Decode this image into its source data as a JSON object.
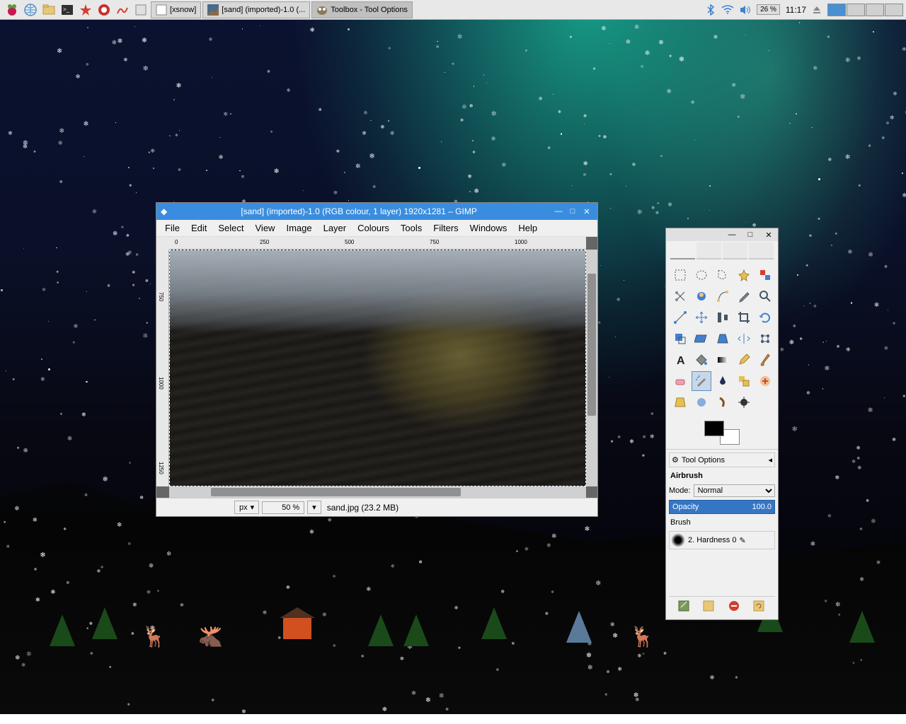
{
  "taskbar": {
    "tasks": [
      {
        "label": "[xsnow]"
      },
      {
        "label": "[sand] (imported)-1.0 (..."
      },
      {
        "label": "Toolbox - Tool Options"
      }
    ],
    "battery": "26 %",
    "clock": "11:17"
  },
  "gimp_main": {
    "title": "[sand] (imported)-1.0 (RGB colour, 1 layer) 1920x1281 – GIMP",
    "menu": [
      "File",
      "Edit",
      "Select",
      "View",
      "Image",
      "Layer",
      "Colours",
      "Tools",
      "Filters",
      "Windows",
      "Help"
    ],
    "ruler_h": [
      "0",
      "250",
      "500",
      "750",
      "1000"
    ],
    "ruler_v": [
      "750",
      "1000",
      "1250"
    ],
    "status": {
      "unit": "px",
      "zoom": "50 %",
      "file": "sand.jpg (23.2 MB)"
    }
  },
  "toolbox": {
    "tools": [
      "rect-select",
      "ellipse-select",
      "free-select",
      "fuzzy-select",
      "color-select",
      "scissors",
      "foreground-select",
      "paths",
      "color-picker",
      "zoom",
      "measure",
      "move",
      "align",
      "crop",
      "rotate",
      "scale",
      "shear",
      "perspective",
      "flip",
      "cage",
      "text",
      "bucket",
      "blend",
      "pencil",
      "paintbrush",
      "eraser",
      "airbrush",
      "ink",
      "clone",
      "heal",
      "perspective-clone",
      "blur",
      "smudge",
      "dodge"
    ],
    "selected_tool": "airbrush",
    "tool_options": {
      "header": "Tool Options",
      "tool_name": "Airbrush",
      "mode_label": "Mode:",
      "mode_value": "Normal",
      "opacity_label": "Opacity",
      "opacity_value": "100.0",
      "brush_label": "Brush",
      "brush_value": "2. Hardness 0"
    }
  },
  "colors": {
    "taskbar_bg": "#e8e8e8",
    "titlebar": "#3a8dde",
    "opacity_bar": "#3576c4"
  }
}
